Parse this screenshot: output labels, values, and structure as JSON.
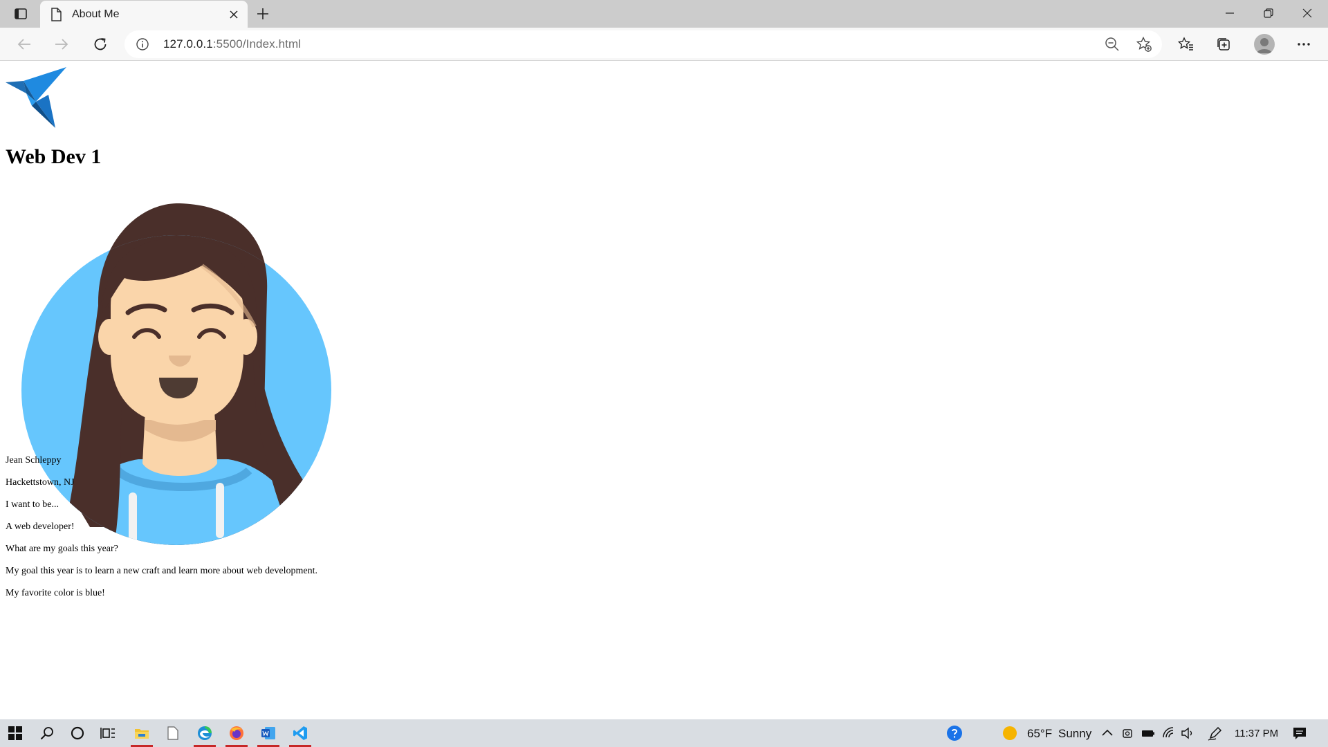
{
  "browser": {
    "tab_title": "About Me",
    "url_host": "127.0.0.1",
    "url_rest": ":5500/Index.html"
  },
  "page": {
    "heading": "Web Dev 1",
    "lines": [
      "Jean Schleppy",
      "Hackettstown, NJ",
      "I want to be...",
      "A web developer!",
      "What are my goals this year?",
      "My goal this year is to learn a new craft and learn more about web development.",
      "My favorite color is blue!"
    ]
  },
  "taskbar": {
    "weather_temp": "65°F",
    "weather_text": "Sunny",
    "clock": "11:37 PM"
  },
  "colors": {
    "chrome_tabstrip": "#cccccc",
    "chrome_toolbar": "#f7f7f7",
    "portrait_circle": "#66c6fd",
    "hair": "#4a2f2a",
    "skin": "#fad5aa",
    "taskbar": "#d9dde2"
  },
  "icons": {
    "logo": "origami-bird-icon",
    "tab_actions": "tab-actions-icon",
    "favicon": "page-icon"
  }
}
